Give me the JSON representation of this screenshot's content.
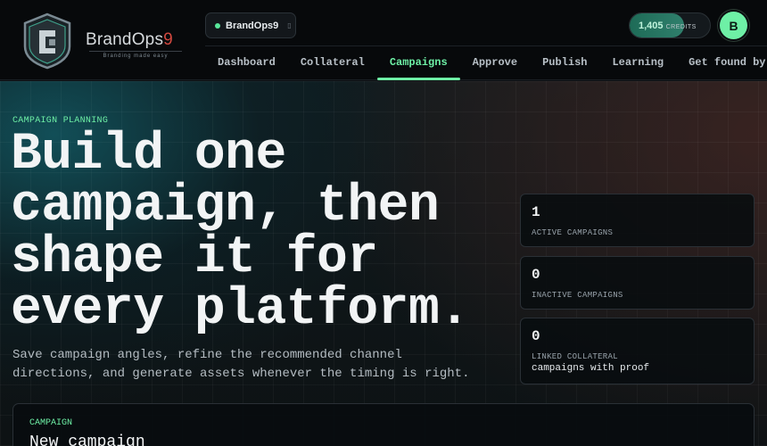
{
  "header": {
    "brand_name": "BrandOps",
    "brand_suffix": "9",
    "tagline": "Branding made easy",
    "workspace": {
      "name": "BrandOps9",
      "status_color": "#59e79a"
    },
    "credits": {
      "value": "1,405",
      "unit": "CREDITS",
      "fill_fraction": 0.68
    },
    "avatar_initial": "B"
  },
  "nav": {
    "items": [
      {
        "label": "Dashboard"
      },
      {
        "label": "Collateral"
      },
      {
        "label": "Campaigns"
      },
      {
        "label": "Approve"
      },
      {
        "label": "Publish"
      },
      {
        "label": "Learning"
      },
      {
        "label": "Get found by AI"
      }
    ],
    "active": "Campaigns",
    "accent": "#6ef0a6"
  },
  "hero": {
    "eyebrow": "CAMPAIGN PLANNING",
    "headline_line1": "Build one",
    "headline_line2": "campaign, then",
    "headline_line3": "shape it for",
    "headline_line4": "every platform.",
    "subcopy_line1": "Save campaign angles, refine the recommended channel",
    "subcopy_line2": "directions, and generate assets whenever the timing is right."
  },
  "stats": [
    {
      "value": "1",
      "label": "ACTIVE CAMPAIGNS",
      "sub": ""
    },
    {
      "value": "0",
      "label": "INACTIVE CAMPAIGNS",
      "sub": ""
    },
    {
      "value": "0",
      "label": "LINKED COLLATERAL",
      "sub": "campaigns with proof"
    }
  ],
  "campaign": {
    "eyebrow": "CAMPAIGN",
    "title": "New campaign"
  }
}
